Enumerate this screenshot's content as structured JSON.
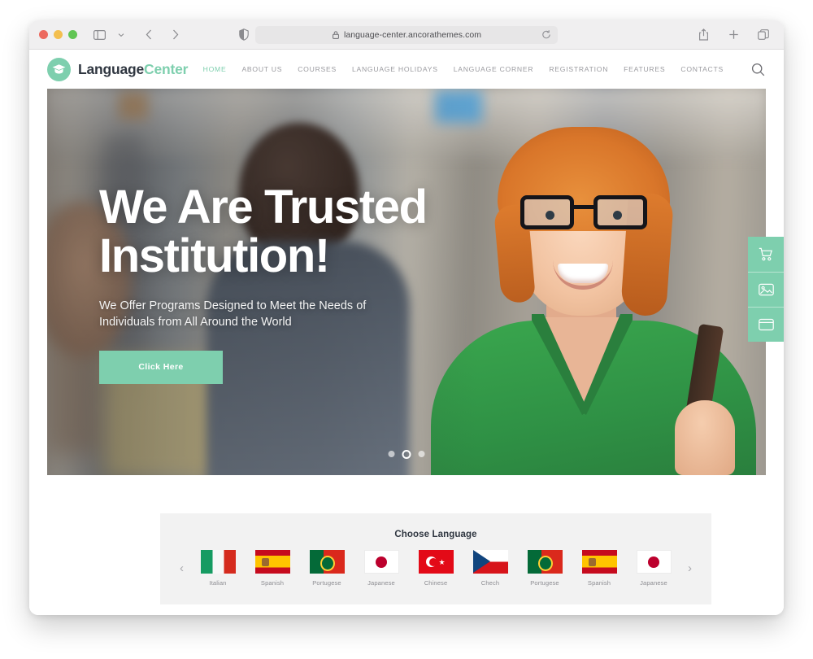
{
  "browser": {
    "url": "language-center.ancorathemes.com",
    "lock_icon": "lock-icon",
    "reload_icon": "reload-icon",
    "sidebar_icon": "sidebar-toggle-icon",
    "sidebar_chevron_icon": "chevron-down-icon",
    "back_icon": "back-arrow-icon",
    "forward_icon": "forward-arrow-icon",
    "shield_icon": "privacy-shield-icon",
    "share_icon": "share-icon",
    "new_tab_icon": "plus-icon",
    "tab_overview_icon": "tab-overview-icon",
    "traffic_lights": [
      "close",
      "minimize",
      "zoom"
    ]
  },
  "site": {
    "logo": {
      "primary": "Language",
      "secondary": "Center",
      "icon": "graduation-cap-icon"
    },
    "nav": [
      {
        "label": "HOME",
        "active": true
      },
      {
        "label": "ABOUT US",
        "active": false
      },
      {
        "label": "COURSES",
        "active": false
      },
      {
        "label": "LANGUAGE HOLIDAYS",
        "active": false
      },
      {
        "label": "LANGUAGE CORNER",
        "active": false
      },
      {
        "label": "REGISTRATION",
        "active": false
      },
      {
        "label": "FEATURES",
        "active": false
      },
      {
        "label": "CONTACTS",
        "active": false
      }
    ],
    "search_icon": "search-icon",
    "hero": {
      "title_line1": "We Are Trusted",
      "title_line2": "Institution!",
      "subtitle_line1": "We Offer Programs Designed to Meet the Needs of",
      "subtitle_line2": "Individuals from All Around the World",
      "cta_label": "Click Here",
      "slides_total": 3,
      "active_slide": 2
    },
    "floating_buttons": [
      {
        "icon": "shopping-cart-icon"
      },
      {
        "icon": "image-gallery-icon"
      },
      {
        "icon": "card-window-icon"
      }
    ],
    "language_chooser": {
      "title": "Choose Language",
      "prev_label": "‹",
      "next_label": "›",
      "items": [
        {
          "label": "Italian",
          "flag": "italy-flag-icon"
        },
        {
          "label": "Spanish",
          "flag": "spain-flag-icon"
        },
        {
          "label": "Portugese",
          "flag": "portugal-flag-icon"
        },
        {
          "label": "Japanese",
          "flag": "japan-flag-icon"
        },
        {
          "label": "Chinese",
          "flag": "turkey-flag-icon"
        },
        {
          "label": "Chech",
          "flag": "czech-flag-icon"
        },
        {
          "label": "Portugese",
          "flag": "portugal-flag-icon"
        },
        {
          "label": "Spanish",
          "flag": "spain-flag-icon"
        },
        {
          "label": "Japanese",
          "flag": "japan-flag-icon"
        }
      ]
    }
  },
  "colors": {
    "accent": "#7ecfae",
    "heading": "#2f3640",
    "nav_text": "#9b9ba0",
    "panel_bg": "#f2f2f2"
  }
}
